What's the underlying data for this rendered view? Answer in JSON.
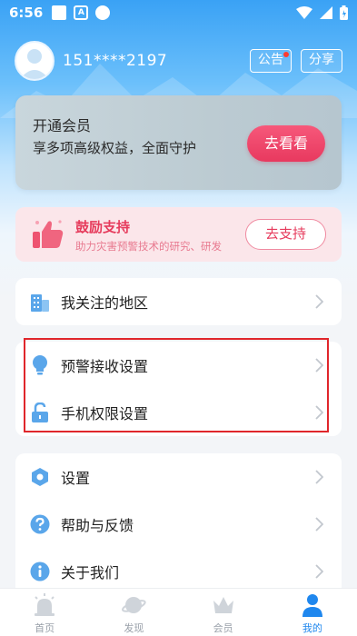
{
  "status_bar": {
    "time": "6:56",
    "a_icon_letter": "A"
  },
  "header": {
    "phone": "151****2197",
    "notice_label": "公告",
    "share_label": "分享"
  },
  "vip": {
    "line1": "开通会员",
    "line2": "享多项高级权益，全面守护",
    "button": "去看看"
  },
  "support": {
    "title": "鼓励支持",
    "subtitle": "助力灾害预警技术的研究、研发",
    "button": "去支持"
  },
  "menu": {
    "regions": "我关注的地区",
    "alert_settings": "预警接收设置",
    "permissions": "手机权限设置",
    "settings": "设置",
    "help": "帮助与反馈",
    "about": "关于我们"
  },
  "tabs": [
    {
      "label": "首页",
      "icon": "home-alarm-icon",
      "active": false
    },
    {
      "label": "发现",
      "icon": "planet-icon",
      "active": false
    },
    {
      "label": "会员",
      "icon": "crown-icon",
      "active": false
    },
    {
      "label": "我的",
      "icon": "person-icon",
      "active": true
    }
  ],
  "colors": {
    "accent_blue": "#1f87ee",
    "vip_button": "#e8395f",
    "support_red": "#e63b5c",
    "highlight_red": "#e0262b"
  }
}
